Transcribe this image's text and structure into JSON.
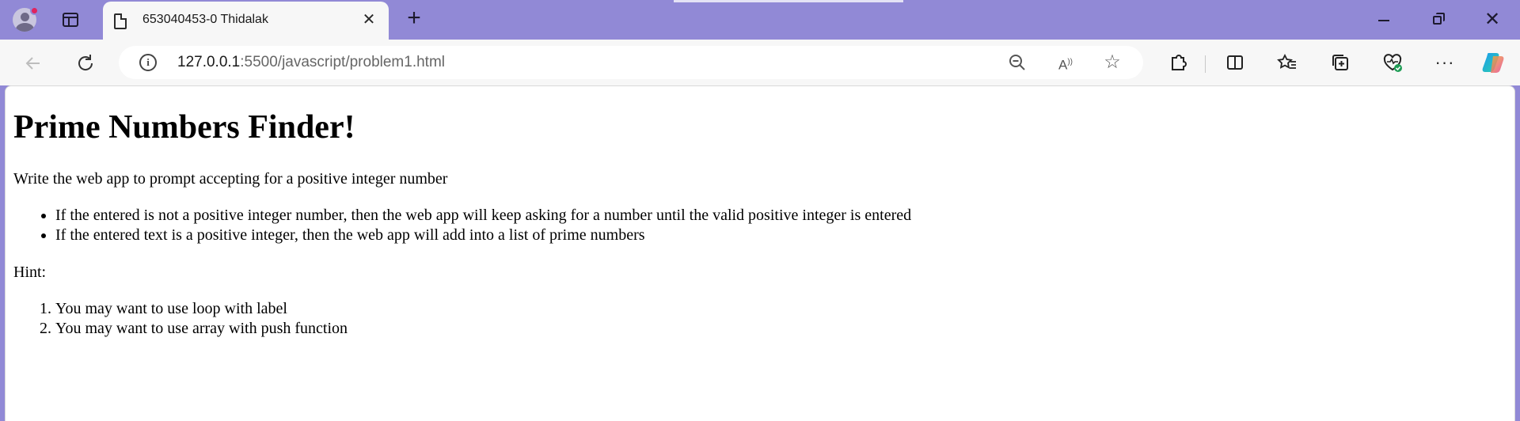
{
  "browser": {
    "tab": {
      "title": "653040453-0 Thidalak"
    },
    "url": {
      "host": "127.0.0.1",
      "rest": ":5500/javascript/problem1.html"
    }
  },
  "page": {
    "heading": "Prime Numbers Finder!",
    "intro": "Write the web app to prompt accepting for a positive integer number",
    "rules": [
      "If the entered is not a positive integer number, then the web app will keep asking for a number until the valid positive integer is entered",
      "If the entered text is a positive integer, then the web app will add into a list of prime numbers"
    ],
    "hint_label": "Hint:",
    "hints": [
      "You may want to use loop with label",
      "You may want to use array with push function"
    ]
  },
  "colors": {
    "titlebar": "#9189d6",
    "toolbar": "#f7f7f7",
    "page_background": "#ffffff"
  },
  "icons": [
    "profile-avatar-icon",
    "tab-actions-icon",
    "page-icon",
    "close-icon",
    "new-tab-icon",
    "minimize-icon",
    "restore-icon",
    "window-close-icon",
    "back-icon",
    "reload-icon",
    "info-icon",
    "zoom-out-icon",
    "read-aloud-icon",
    "favorite-star-icon",
    "extensions-icon",
    "split-screen-icon",
    "favorites-icon",
    "collections-icon",
    "browser-essentials-icon",
    "more-icon",
    "copilot-icon"
  ]
}
